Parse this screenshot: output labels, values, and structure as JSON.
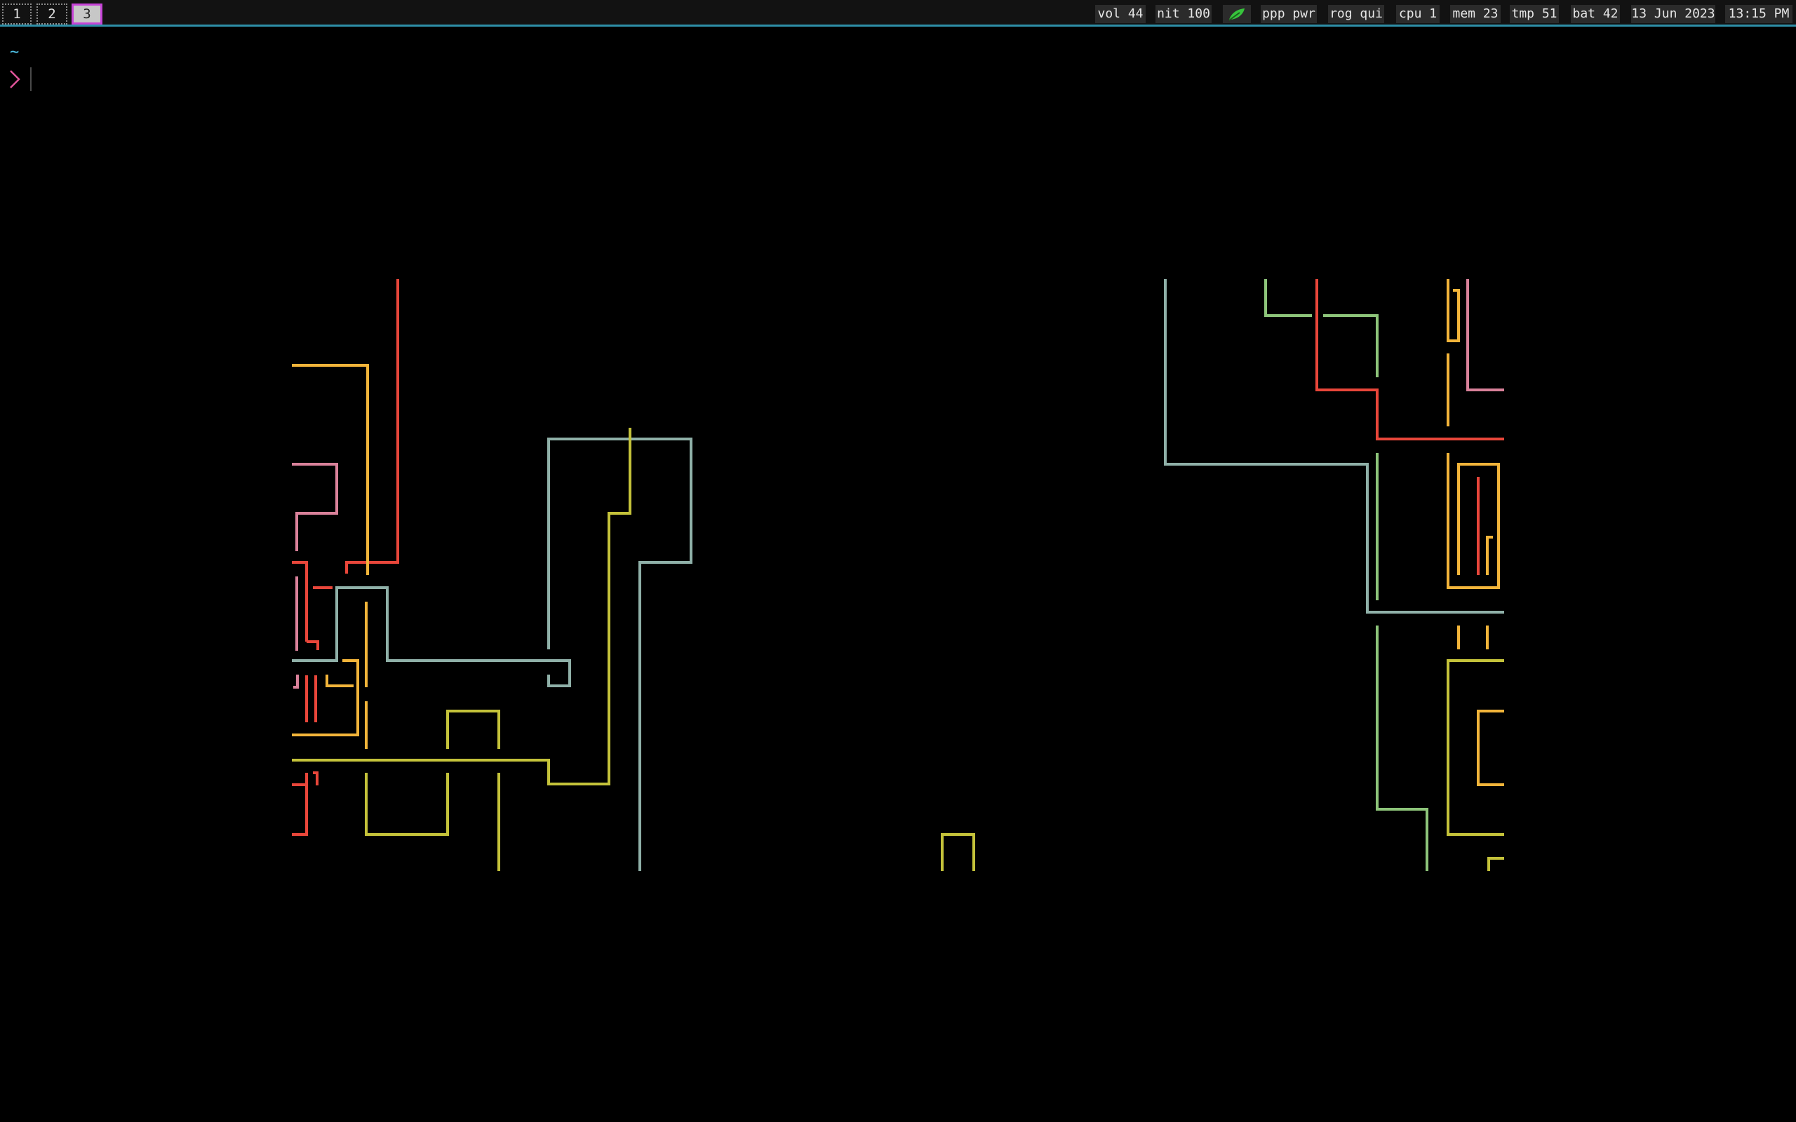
{
  "workspaces": [
    {
      "label": "1",
      "active": false
    },
    {
      "label": "2",
      "active": false
    },
    {
      "label": "3",
      "active": true
    }
  ],
  "status": {
    "volume": "vol 44",
    "brightness": "nit 100",
    "power_profile": "ppp pwr",
    "rog_profile": "rog qui",
    "cpu": "cpu 1",
    "memory": "mem 23",
    "temperature": "tmp 51",
    "battery": "bat 42",
    "date": "13 Jun 2023",
    "time": "13:15 PM"
  },
  "terminal": {
    "cwd": "~",
    "prompt_symbol": "❯"
  },
  "colors": {
    "accent": "#2e8fa8",
    "active_workspace_border": "#c643d6",
    "cwd": "#4fc3e8",
    "prompt": "#e0559a",
    "leaf_icon": "#37c43c",
    "pipe_red": "#e8463a",
    "pipe_orange": "#f2b43a",
    "pipe_pink": "#d9819a",
    "pipe_teal": "#8fb0a8",
    "pipe_olive": "#c4c23a",
    "pipe_green": "#8dc47a"
  }
}
